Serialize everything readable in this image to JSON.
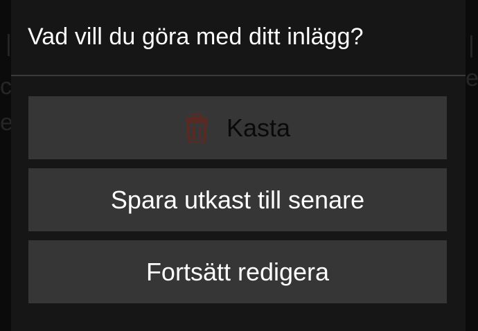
{
  "dialog": {
    "title": "Vad vill du göra med ditt inlägg?",
    "options": [
      {
        "label": "Kasta",
        "icon": "trash-icon",
        "disabled": true,
        "icon_color": "#5a2a22"
      },
      {
        "label": "Spara utkast till senare",
        "disabled": false
      },
      {
        "label": "Fortsätt redigera",
        "disabled": false
      }
    ]
  },
  "colors": {
    "dialog_bg": "#161616",
    "button_bg": "#363636",
    "text": "#ffffff",
    "disabled_text": "#0a0a0a"
  }
}
